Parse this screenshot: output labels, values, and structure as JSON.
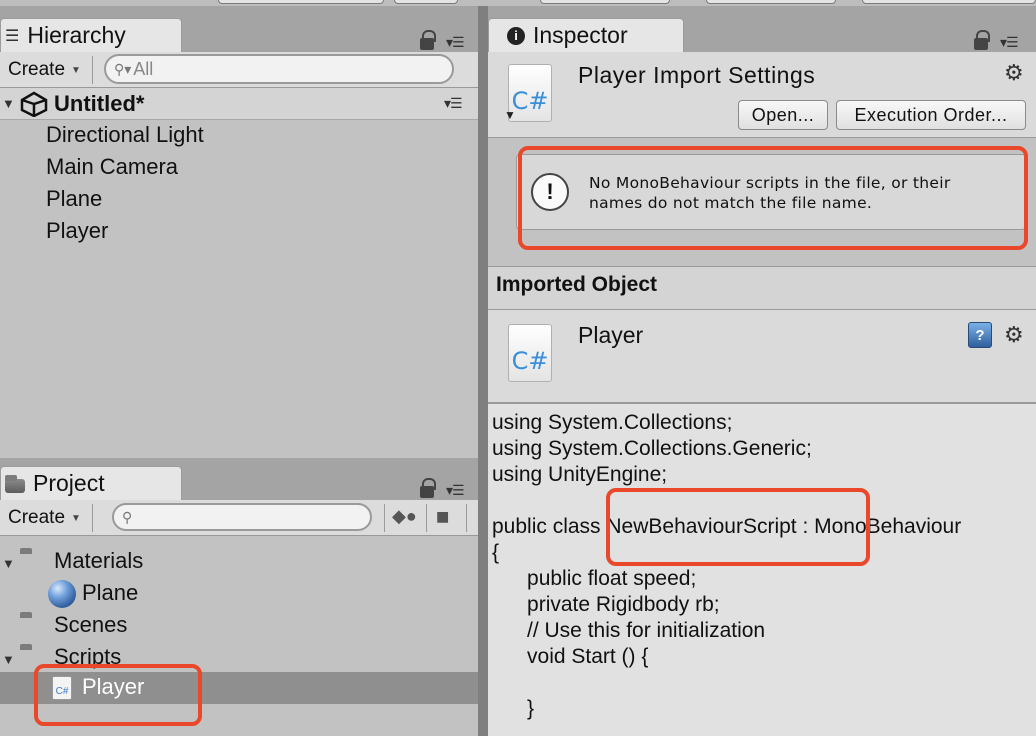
{
  "hierarchy": {
    "tab_label": "Hierarchy",
    "create_label": "Create",
    "search_placeholder": "All",
    "scene_name": "Untitled*",
    "items": [
      "Directional Light",
      "Main Camera",
      "Plane",
      "Player"
    ]
  },
  "project": {
    "tab_label": "Project",
    "create_label": "Create",
    "tree": [
      {
        "label": "Materials",
        "kind": "folder"
      },
      {
        "label": "Plane",
        "kind": "material"
      },
      {
        "label": "Scenes",
        "kind": "folder"
      },
      {
        "label": "Scripts",
        "kind": "folder"
      },
      {
        "label": "Player",
        "kind": "script",
        "selected": true
      }
    ]
  },
  "inspector": {
    "tab_label": "Inspector",
    "import_title": "Player Import Settings",
    "open_label": "Open...",
    "exec_order_label": "Execution Order...",
    "warning": "No MonoBehaviour scripts in the file, or their\nnames do not match the file name.",
    "imported_header": "Imported Object",
    "object_name": "Player",
    "script_icon_text": "C#",
    "code_lines": [
      "using System.Collections;",
      "using System.Collections.Generic;",
      "using UnityEngine;",
      "",
      "public class NewBehaviourScript : MonoBehaviour",
      "{",
      "\tpublic float speed;",
      "\tprivate Rigidbody rb;",
      "\t// Use this for initialization",
      "\tvoid Start () {",
      "",
      "\t}"
    ]
  },
  "colors": {
    "highlight": "#e9482a",
    "selection": "#8f8f8f"
  }
}
